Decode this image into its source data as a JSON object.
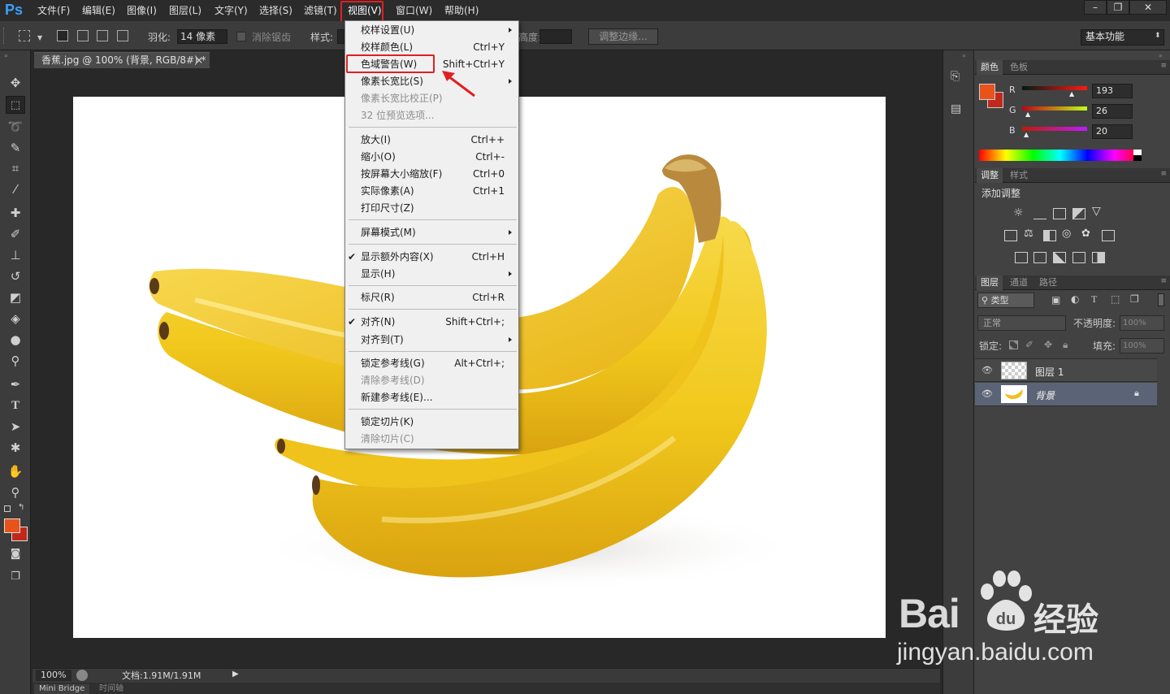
{
  "app": {
    "logo": "Ps"
  },
  "menubar": {
    "items": [
      "文件(F)",
      "编辑(E)",
      "图像(I)",
      "图层(L)",
      "文字(Y)",
      "选择(S)",
      "滤镜(T)",
      "视图(V)",
      "窗口(W)",
      "帮助(H)"
    ],
    "active": "视图(V)",
    "window_buttons": [
      "–",
      "❐",
      "✕"
    ]
  },
  "options": {
    "feather_label": "羽化:",
    "feather_value": "14 像素",
    "antialias_label": "消除锯齿",
    "style_label": "样式:",
    "height_label": "高度:",
    "refine_button": "调整边缘...",
    "workspace": "基本功能"
  },
  "document": {
    "tab_title": "香蕉.jpg @ 100% (背景, RGB/8#) *",
    "tab_close": "×",
    "zoom": "100%",
    "doc_info": "文档:1.91M/1.91M"
  },
  "bottom_tabs": [
    "Mini Bridge",
    "时间轴"
  ],
  "view_menu": {
    "items": [
      {
        "label": "校样设置(U)",
        "shortcut": "",
        "submenu": true
      },
      {
        "label": "校样颜色(L)",
        "shortcut": "Ctrl+Y"
      },
      {
        "label": "色域警告(W)",
        "shortcut": "Shift+Ctrl+Y",
        "highlighted": true
      },
      {
        "label": "像素长宽比(S)",
        "shortcut": "",
        "submenu": true
      },
      {
        "label": "像素长宽比校正(P)",
        "shortcut": "",
        "disabled": true
      },
      {
        "label": "32 位预览选项...",
        "shortcut": "",
        "disabled": true
      },
      {
        "label": "放大(I)",
        "shortcut": "Ctrl++"
      },
      {
        "label": "缩小(O)",
        "shortcut": "Ctrl+-"
      },
      {
        "label": "按屏幕大小缩放(F)",
        "shortcut": "Ctrl+0"
      },
      {
        "label": "实际像素(A)",
        "shortcut": "Ctrl+1"
      },
      {
        "label": "打印尺寸(Z)",
        "shortcut": ""
      },
      {
        "label": "屏幕模式(M)",
        "shortcut": "",
        "submenu": true
      },
      {
        "label": "显示额外内容(X)",
        "shortcut": "Ctrl+H",
        "checked": true
      },
      {
        "label": "显示(H)",
        "shortcut": "",
        "submenu": true
      },
      {
        "label": "标尺(R)",
        "shortcut": "Ctrl+R"
      },
      {
        "label": "对齐(N)",
        "shortcut": "Shift+Ctrl+;",
        "checked": true
      },
      {
        "label": "对齐到(T)",
        "shortcut": "",
        "submenu": true
      },
      {
        "label": "锁定参考线(G)",
        "shortcut": "Alt+Ctrl+;"
      },
      {
        "label": "清除参考线(D)",
        "shortcut": "",
        "disabled": true
      },
      {
        "label": "新建参考线(E)...",
        "shortcut": ""
      },
      {
        "label": "锁定切片(K)",
        "shortcut": ""
      },
      {
        "label": "清除切片(C)",
        "shortcut": "",
        "disabled": true
      }
    ]
  },
  "color_panel": {
    "tabs": [
      "颜色",
      "色板"
    ],
    "r_label": "R",
    "g_label": "G",
    "b_label": "B",
    "r": "193",
    "g": "26",
    "b": "20",
    "foreground": "#e8531c",
    "background": "#c1281c"
  },
  "adjust_panel": {
    "tabs": [
      "调整",
      "样式"
    ],
    "title": "添加调整"
  },
  "layers_panel": {
    "tabs": [
      "图层",
      "通道",
      "路径"
    ],
    "filter_label": "类型",
    "blend_mode": "正常",
    "opacity_label": "不透明度:",
    "opacity_value": "100%",
    "lock_label": "锁定:",
    "fill_label": "填充:",
    "fill_value": "100%",
    "layers": [
      {
        "name": "图层 1",
        "visible": true
      },
      {
        "name": "背景",
        "visible": true,
        "locked": true,
        "selected": true
      }
    ]
  },
  "watermark": {
    "logo": "Bai",
    "logo_cn": "经验",
    "url": "jingyan.baidu.com"
  }
}
